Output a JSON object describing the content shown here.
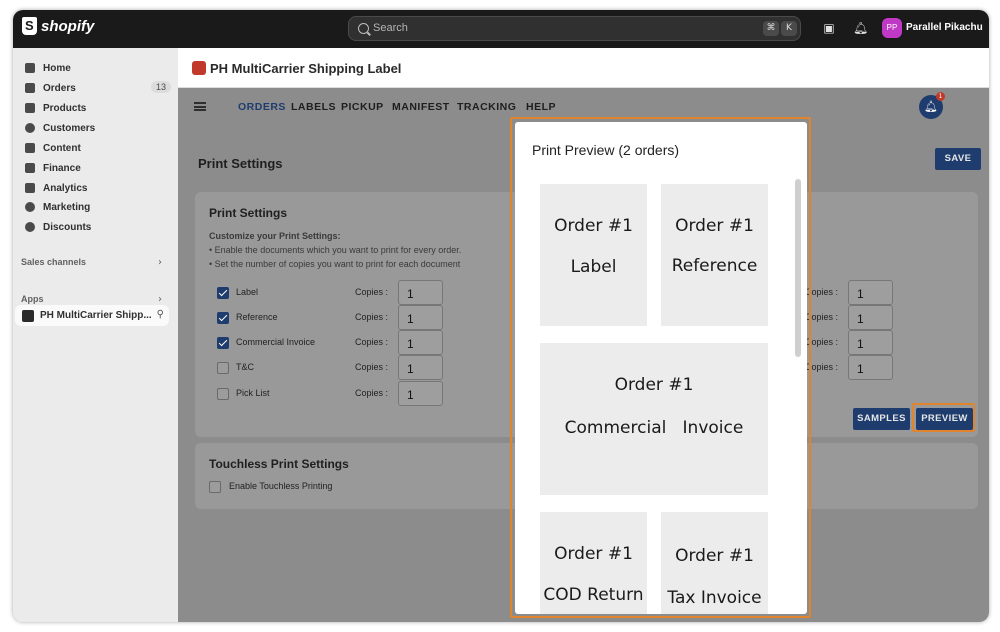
{
  "topbar": {
    "brand": "shopify",
    "search_placeholder": "Search",
    "kbd_cmd": "⌘",
    "kbd_k": "K",
    "user_initials": "PP",
    "user_name": "Parallel Pikachu"
  },
  "sidebar": {
    "items": [
      {
        "label": "Home",
        "icon": "home-icon"
      },
      {
        "label": "Orders",
        "icon": "orders-icon",
        "badge": "13"
      },
      {
        "label": "Products",
        "icon": "tag-icon"
      },
      {
        "label": "Customers",
        "icon": "person-icon"
      },
      {
        "label": "Content",
        "icon": "content-icon"
      },
      {
        "label": "Finance",
        "icon": "bank-icon"
      },
      {
        "label": "Analytics",
        "icon": "chart-icon"
      },
      {
        "label": "Marketing",
        "icon": "target-icon"
      },
      {
        "label": "Discounts",
        "icon": "discount-icon"
      }
    ],
    "sales_channels": "Sales channels",
    "apps": "Apps",
    "app_item": "PH MultiCarrier Shipp..."
  },
  "app": {
    "title": "PH MultiCarrier Shipping Label",
    "tabs": [
      "ORDERS",
      "LABELS",
      "PICKUP",
      "MANIFEST",
      "TRACKING",
      "HELP"
    ],
    "notification_count": "1",
    "page_title": "Print Settings",
    "save": "SAVE"
  },
  "print_settings": {
    "title": "Print Settings",
    "customize": "Customize your Print Settings:",
    "note1": "• Enable the documents which you want to print for every order.",
    "note2": "• Set the number of copies you want to print for each document",
    "copies_label": "Copies :",
    "rows": [
      {
        "label": "Label",
        "checked": true,
        "copies": "1"
      },
      {
        "label": "Reference",
        "checked": true,
        "copies": "1"
      },
      {
        "label": "Commercial Invoice",
        "checked": true,
        "copies": "1"
      },
      {
        "label": "T&C",
        "checked": false,
        "copies": "1"
      },
      {
        "label": "Pick List",
        "checked": false,
        "copies": "1"
      }
    ],
    "right_copies": [
      "1",
      "1",
      "1",
      "1"
    ],
    "samples": "SAMPLES",
    "preview": "PREVIEW"
  },
  "touchless": {
    "title": "Touchless Print Settings",
    "option": "Enable Touchless Printing"
  },
  "modal": {
    "title": "Print Preview (2 orders)",
    "pages": [
      {
        "line1": "Order #1",
        "line2": "Label"
      },
      {
        "line1": "Order #1",
        "line2": "Reference"
      },
      {
        "line1": "Order #1",
        "line2": "Commercial   Invoice"
      },
      {
        "line1": "Order #1",
        "line2": "COD Return"
      },
      {
        "line1": "Order #1",
        "line2": "Tax Invoice"
      }
    ]
  },
  "colors": {
    "accent": "#1f3c6e",
    "highlight": "#e0852d",
    "overlay": "#8c8c8c"
  }
}
